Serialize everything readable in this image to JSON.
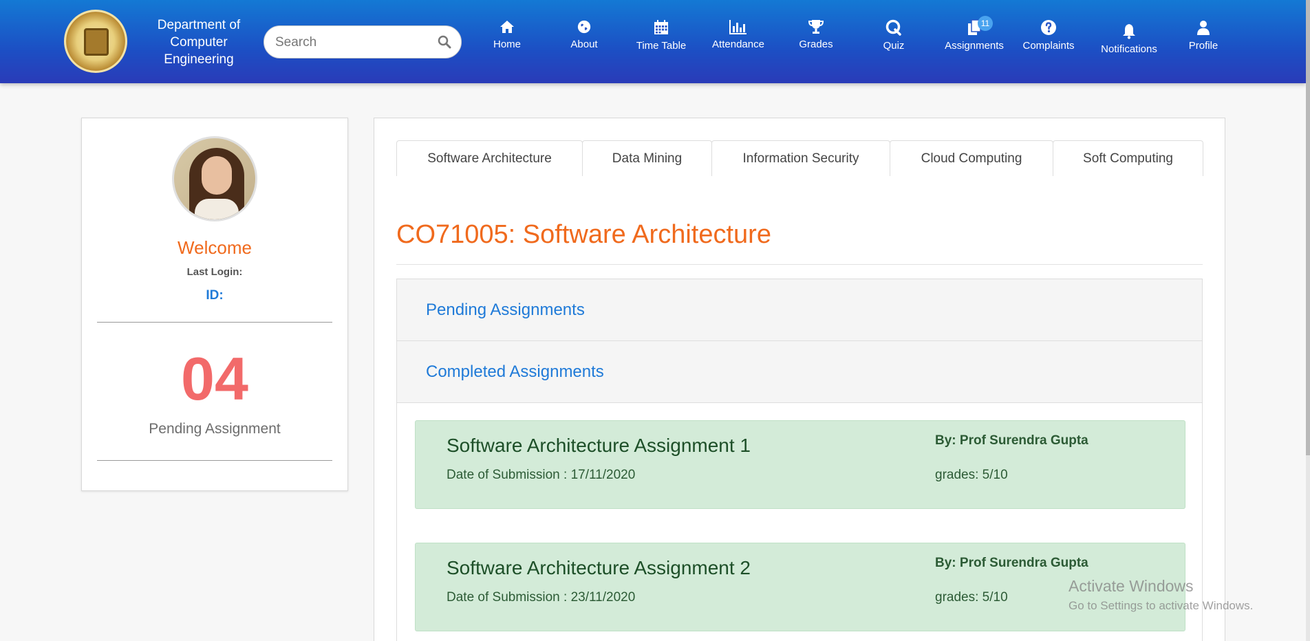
{
  "header": {
    "dept_line1": "Department of",
    "dept_line2": "Computer",
    "dept_line3": "Engineering",
    "search_placeholder": "Search",
    "nav": [
      {
        "label": "Home",
        "icon": "home-icon"
      },
      {
        "label": "About",
        "icon": "globe-icon"
      },
      {
        "label": "Time Table",
        "icon": "calendar-icon"
      },
      {
        "label": "Attendance",
        "icon": "bar-chart-icon"
      },
      {
        "label": "Grades",
        "icon": "trophy-icon"
      },
      {
        "label": "Quiz",
        "icon": "quiz-icon"
      },
      {
        "label": "Assignments",
        "icon": "copy-icon",
        "badge": "11"
      },
      {
        "label": "Complaints",
        "icon": "question-icon"
      },
      {
        "label": "Notifications",
        "icon": "bell-icon"
      },
      {
        "label": "Profile",
        "icon": "user-icon"
      }
    ]
  },
  "profile": {
    "welcome": "Welcome",
    "last_login": "Last Login:",
    "id_label": "ID:",
    "pending_count": "04",
    "pending_label": "Pending Assignment"
  },
  "tabs": [
    "Software Architecture",
    "Data Mining",
    "Information Security",
    "Cloud Computing",
    "Soft Computing"
  ],
  "course_title": "CO71005: Software Architecture",
  "sections": {
    "pending": "Pending Assignments",
    "completed": "Completed Assignments"
  },
  "assignments": [
    {
      "title": "Software Architecture Assignment 1",
      "date": "Date of Submission : 17/11/2020",
      "by": "By: Prof Surendra Gupta",
      "grades": "grades: 5/10"
    },
    {
      "title": "Software Architecture Assignment 2",
      "date": "Date of Submission : 23/11/2020",
      "by": "By: Prof Surendra Gupta",
      "grades": "grades: 5/10"
    }
  ],
  "watermark": {
    "line1": "Activate Windows",
    "line2": "Go to Settings to activate Windows."
  },
  "colors": {
    "header_blue": "#1c4fc4",
    "accent_orange": "#f06a1d",
    "link_blue": "#1f7ad8",
    "card_green": "#d3ebd8",
    "pending_red": "#f26a6a"
  }
}
